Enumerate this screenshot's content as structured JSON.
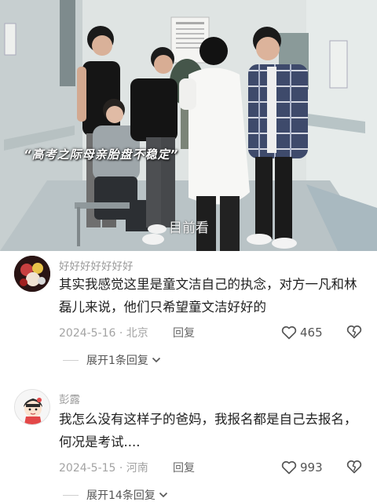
{
  "video": {
    "caption_top": "“高考之际母亲胎盘不稳定”",
    "caption_bottom": "目前看"
  },
  "comments": [
    {
      "username": "好好好好好好好",
      "text": "其实我感觉这里是童文洁自己的执念，对方一凡和林磊儿来说，他们只希望童文洁好好的",
      "date": "2024-5-16 · 北京",
      "reply_label": "回复",
      "likes": "465",
      "expand_label": "展开1条回复"
    },
    {
      "username": "彭露",
      "text": "我怎么没有这样子的爸妈，我报名都是自己去报名，何况是考试....",
      "date": "2024-5-15 · 河南",
      "reply_label": "回复",
      "likes": "993",
      "expand_label": "展开14条回复"
    }
  ],
  "icons": {
    "like": "heart-outline-icon",
    "dislike": "broken-heart-icon",
    "expand": "chevron-down-icon"
  },
  "colors": {
    "meta_gray": "#a3a3a3",
    "username_gray": "#9a9a9a"
  }
}
